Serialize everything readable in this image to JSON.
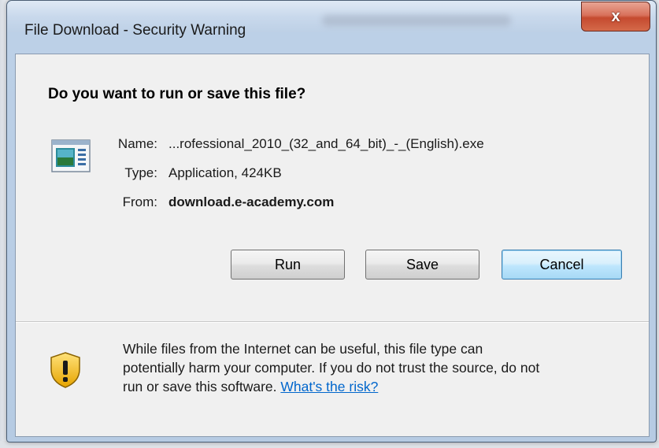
{
  "window": {
    "title": "File Download - Security Warning",
    "close_label": "x"
  },
  "dialog": {
    "heading": "Do you want to run or save this file?",
    "name_label": "Name:",
    "name_value": "...rofessional_2010_(32_and_64_bit)_-_(English).exe",
    "type_label": "Type:",
    "type_value": "Application, 424KB",
    "from_label": "From:",
    "from_value": "download.e-academy.com",
    "buttons": {
      "run": "Run",
      "save": "Save",
      "cancel": "Cancel"
    },
    "warning_line1": "While files from the Internet can be useful, this file type can",
    "warning_line2": "potentially harm your computer. If you do not trust the source, do not",
    "warning_line3_prefix": "run or save this software. ",
    "risk_link": "What's the risk?"
  },
  "icons": {
    "file": "application-window-icon",
    "warning": "security-shield-warning-icon"
  },
  "colors": {
    "link": "#0066cc",
    "close_button": "#c54a2f",
    "default_button_border": "#3c7fb1"
  }
}
